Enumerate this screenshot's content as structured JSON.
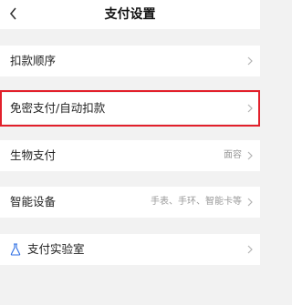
{
  "header": {
    "title": "支付设置",
    "back_icon": "chevron-left-icon"
  },
  "rows": [
    {
      "label": "扣款顺序",
      "value": ""
    },
    {
      "label": "免密支付/自动扣款",
      "value": ""
    },
    {
      "label": "生物支付",
      "value": "面容"
    },
    {
      "label": "智能设备",
      "value": "手表、手环、智能卡等"
    },
    {
      "label": "支付实验室",
      "value": "",
      "icon": "flask-icon"
    }
  ],
  "colors": {
    "background": "#f2f2f2",
    "row_background": "#ffffff",
    "highlight_border": "#e2202b",
    "accent_icon": "#2f6fe4",
    "secondary_text": "#9a9a9a"
  }
}
